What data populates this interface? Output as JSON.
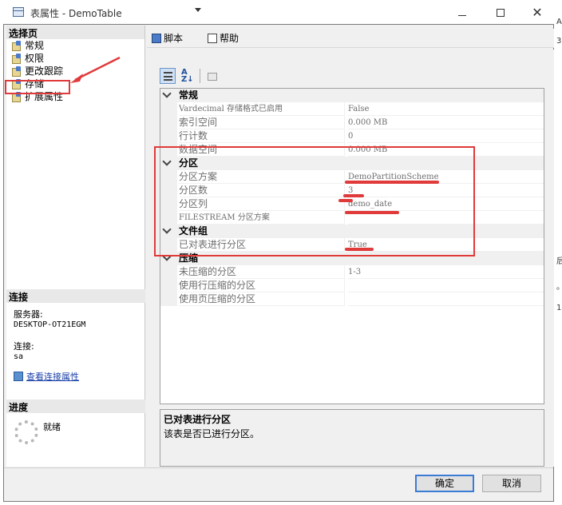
{
  "window": {
    "title": "表属性 - DemoTable",
    "minimize": "—",
    "close": "✕"
  },
  "left": {
    "select_page_header": "选择页",
    "nav_items": [
      {
        "label": "常规"
      },
      {
        "label": "权限"
      },
      {
        "label": "更改跟踪"
      },
      {
        "label": "存储"
      },
      {
        "label": "扩展属性"
      }
    ],
    "connection_header": "连接",
    "server_label": "服务器:",
    "server_value": "DESKTOP-OT21EGM",
    "connection_label": "连接:",
    "connection_value": "sa",
    "view_connection_link": "查看连接属性",
    "progress_header": "进度",
    "progress_status": "就绪"
  },
  "toolbar": {
    "script_label": "脚本",
    "help_label": "帮助"
  },
  "prop_toolbar": {
    "sort_alpha_label": "A\nZ↓"
  },
  "grid": {
    "categories": [
      {
        "name": "常规",
        "rows": [
          {
            "name": "Vardecimal 存储格式已启用",
            "value": "False"
          },
          {
            "name": "索引空间",
            "value": "0.000 MB"
          },
          {
            "name": "行计数",
            "value": "0"
          },
          {
            "name": "数据空间",
            "value": "0.000 MB"
          }
        ]
      },
      {
        "name": "分区",
        "rows": [
          {
            "name": "分区方案",
            "value": "DemoPartitionScheme"
          },
          {
            "name": "分区数",
            "value": "3"
          },
          {
            "name": "分区列",
            "value": "demo_date"
          },
          {
            "name": "FILESTREAM 分区方案",
            "value": ""
          }
        ]
      },
      {
        "name": "文件组",
        "rows": [
          {
            "name": "已对表进行分区",
            "value": "True"
          }
        ]
      },
      {
        "name": "压缩",
        "rows": [
          {
            "name": "未压缩的分区",
            "value": "1-3"
          },
          {
            "name": "使用行压缩的分区",
            "value": ""
          },
          {
            "name": "使用页压缩的分区",
            "value": ""
          }
        ]
      }
    ]
  },
  "description": {
    "title": "已对表进行分区",
    "text": "该表是否已进行分区。"
  },
  "buttons": {
    "ok": "确定",
    "cancel": "取消"
  },
  "edge_text": {
    "a": "A",
    "b": "3",
    "c": "后",
    "d": "。",
    "e": "1"
  },
  "colors": {
    "annotation_red": "#e03a3a",
    "link_blue": "#1a3fa8",
    "primary_button_border": "#3a7bd5"
  }
}
